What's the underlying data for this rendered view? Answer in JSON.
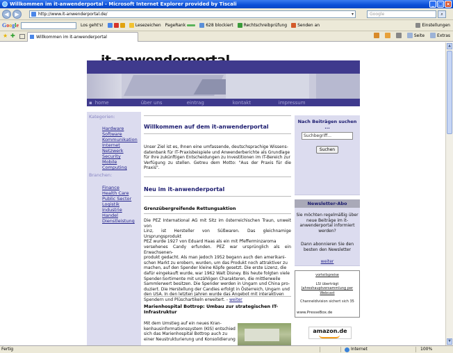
{
  "window": {
    "title": "Willkommen im it-anwenderportal - Microsoft Internet Explorer provided by Tiscali"
  },
  "address_bar": {
    "url": "http://www.it-anwenderportal.de/",
    "search_placeholder": "Google"
  },
  "google_toolbar": {
    "logo": [
      "G",
      "o",
      "o",
      "g",
      "l",
      "e"
    ],
    "search_button": "Los geht's!",
    "items": [
      "Lesezeichen",
      "PageRank",
      "628 blockiert",
      "Rechtschreibprüfung",
      "Senden an"
    ],
    "settings": "Einstellungen"
  },
  "tabs": [
    {
      "label": "Willkommen im it-anwenderportal"
    }
  ],
  "command_bar": [
    "Seite",
    "Extras"
  ],
  "status": {
    "text": "Fertig",
    "zone": "Internet",
    "zoom": "100%"
  },
  "site": {
    "brand": "it-anwenderportal",
    "nav": [
      "home",
      "über uns",
      "eintrag",
      "kontakt",
      "impressum"
    ],
    "categories_label": "Kategorien:",
    "categories": [
      "Hardware",
      "Software",
      "Kommunikation",
      "Internet",
      "Netzwerk",
      "Security",
      "Mobile Computing"
    ],
    "branchen_label": "Branchen:",
    "branchen": [
      "Finance",
      "Health Care",
      "Public Sector",
      "Logistik",
      "Industrie",
      "Handel",
      "Dienstleistung"
    ],
    "welcome_title": "Willkommen auf dem it-anwenderportal",
    "welcome_lines": [
      "Unser Ziel ist es, Ihnen eine umfassende, deutschsprachige Wissens-",
      "datenbank für IT-Praxisbeispiele und Anwenderberichte als Grundlage",
      "für Ihre zukünftigen Entscheidungen zu Investitionen im IT-Bereich zur",
      "Verfügung zu stellen. Getreu dem Motto: \"Aus der Praxis für die Praxis\"."
    ],
    "new_title": "Neu im it-anwenderportal",
    "article1_title": "Grenzübergreifende Rettungsaktion",
    "article1_lines": [
      "Die PEZ International AG mit Sitz im österreichischen Traun, unweit von",
      "Linz, ist Hersteller von Süßwaren. Das gleichnamige Ursprungsprodukt",
      "PEZ wurde 1927 von Eduard Haas als ein mit Pfefferminzaroma",
      "versehenes Candy erfunden. PEZ war ursprünglich als ein Erwachsenen-",
      "produkt gedacht. Als man jedoch 1952 begann auch den amerikani-",
      "schen Markt zu erobern, wurden, um das Produkt noch attraktiver zu",
      "machen, auf den Spender kleine Köpfe gesetzt. Die erste Lizenz, die",
      "dafür eingekauft wurde, war 1962 Walt Disney. Bis heute folgten viele",
      "Spender-Sortimente mit unzähligen Charakteren, die mittlerweile",
      "Sammlerwert besitzen. Die Spender werden in Ungarn und China pro-",
      "duziert. Die Herstellung der Candies erfolgt in Österreich, Ungarn und",
      "den USA. In den letzten Jahren wurde das Angebot mit interaktiven",
      "Spendern und Plüschartikeln erweitert. -"
    ],
    "more_link": "weiter",
    "article2_title_lines": [
      "Marienhospital Bottrop: Umbau zur strategischen IT-",
      "Infrastruktur"
    ],
    "article2_lines": [
      "Mit dem Umstieg auf ein neues Kran-",
      "kenhausinformationssystem (KIS) entschied",
      "sich das Marienhospital Bottrop auch zu",
      "einer Neustrukturierung und Konsolidierung"
    ],
    "search_box": {
      "title": "Nach Beiträgen suchen ...",
      "input_value": "Suchbegriff...",
      "button": "Suchen"
    },
    "newsletter": {
      "title": "Newsletter-Abo",
      "lines": [
        "Sie möchten regelmäßig über",
        "neue Beiträge im it-",
        "anwenderportal informiert",
        "werden?"
      ],
      "lines2": [
        "Dann abonnieren Sie den",
        "besten den Newsletter"
      ],
      "link": "weiter"
    },
    "pressbox": {
      "lines": [
        "vorteilspreise",
        "",
        "LSI überträgt",
        "Jahreshauptversammlung per",
        "Webcast",
        "",
        "Channeldivision sichert sich 35"
      ],
      "footer": "www.PresseBox.de"
    },
    "amazon": "amazon.de"
  },
  "colors": {
    "brand_purple": "#3f3a8d",
    "sidebar_bg": "#dcdcef",
    "title_blue": "#1a1a6e"
  }
}
